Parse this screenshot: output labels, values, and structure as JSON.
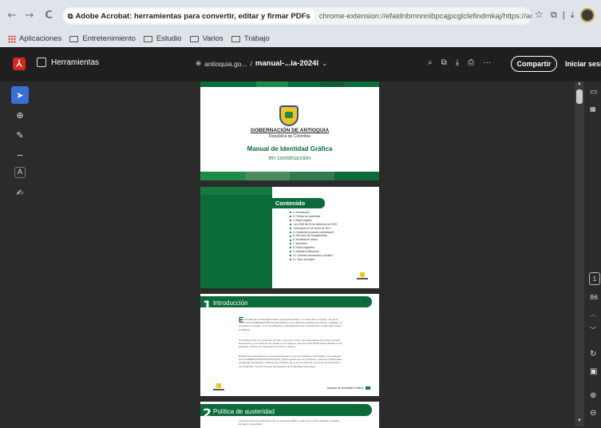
{
  "browser": {
    "back": "←",
    "forward": "→",
    "reload": "C",
    "site_chip": "Adobe Acrobat: herramientas para convertir, editar y firmar PDFs",
    "url": "chrome-extension://efaidnbmnnnibpcajpcglclefindmkaj/https://antioquia.gov.co/imag...",
    "star": "☆",
    "ext_icon": "⧉",
    "divider": "|",
    "download_icon": "⤓"
  },
  "bookmarks": [
    {
      "label": "Aplicaciones",
      "icon": "apps-grid-icon"
    },
    {
      "label": "Entretenimiento",
      "icon": "folder-icon"
    },
    {
      "label": "Estudio",
      "icon": "folder-icon"
    },
    {
      "label": "Varios",
      "icon": "folder-icon"
    },
    {
      "label": "Trabajo",
      "icon": "folder-icon"
    }
  ],
  "acrobat": {
    "logo_glyph": "⅄",
    "tools_label": "Herramientas",
    "doc_site": "antioquia.go...",
    "doc_sep": "/",
    "doc_name": "manual-...ia-2024l",
    "chevron": "⌄",
    "share_label": "Compartir",
    "login_label": "Iniciar sesión",
    "icons": [
      "search-icon",
      "copy-icon",
      "download-icon",
      "print-icon",
      "more-icon"
    ],
    "icon_glyphs": [
      "⌕",
      "⧉",
      "⤓",
      "⎙",
      "···"
    ]
  },
  "left_tools": [
    {
      "name": "select-tool",
      "glyph": "➤"
    },
    {
      "name": "comment-tool",
      "glyph": "⊕"
    },
    {
      "name": "draw-tool",
      "glyph": "✎"
    },
    {
      "name": "link-tool",
      "glyph": "∽"
    },
    {
      "name": "text-tool",
      "glyph": "A"
    },
    {
      "name": "sign-tool",
      "glyph": "✍"
    }
  ],
  "right_panel": {
    "page_number": "1",
    "total_pages": "86",
    "icons": [
      "comment-panel-icon",
      "thumbnails-icon",
      "page-up-icon",
      "page-down-icon",
      "rotate-icon",
      "save-icon",
      "zoom-in-icon",
      "zoom-out-icon"
    ]
  },
  "pages": {
    "cover": {
      "gov_name": "GOBERNACIÓN DE ANTIOQUIA",
      "gov_sub": "República de Colombia",
      "title": "Manual de Identidad Gráfica",
      "subtitle": "en construcción"
    },
    "contents": {
      "title": "Contenido",
      "items": [
        "1. Introducción",
        "2. Política de austeridad",
        "3. Bases legales",
        "    Ley 2345 del 30 de diciembre de 2023",
        "    Ordenanza 02 de marzo de 2017",
        "4. Lineamientos para la contratación",
        "5. Símbolos del Departamento",
        "6. Identidad de marca",
        "7. Aplicación",
        "8. Estilo fotográfico",
        "9. Material institucional",
        "10. Cambios autorizados y usuales",
        "11. Otros mensajes"
      ]
    },
    "intro": {
      "number": "1",
      "title": "Introducción",
      "dropcap": "E",
      "paragraphs": [
        "ste Manual de Identidad Gráfica presenta las bases y normas para el correcto uso de la marca GOBERNACIÓN DE ANTIOQUIA en las diferentes aplicaciones físicas y digitales, su orientación a imagen, su reconocibilidad y visibilidad para que pueda aportar a cada valor visual y su difusión.",
        "Se deberán tener en cuenta las normas y tener del mismo, para adecuarlas a la marca y demás lineamientos, por medio de uso similar en los criterios, para que la identidad tenga claridad en las planchas y formas de comunicación interna y externa.",
        "El Manual de Identidad es una herramienta para el uso de entidades, contratistas y proveedores de la GOBERNACIÓN DE ANTIOQUIA, para la gestión de comunicación y para los profesionales encargados de diseñar y difundir de la entidad, con el fin de optimizar el proceso de producción de contenidos, con los recursos de la gestión de la identidad corporativa."
      ],
      "footer": "Manual de Identidad Gráfica",
      "footer_page": "3"
    },
    "austerity": {
      "number": "2",
      "title": "Política de austeridad",
      "paragraph": "La Gobernación de Antioquia como en el Estado público, todo por lo cual se aplicarán medidas de gasto y austeridad..."
    }
  }
}
